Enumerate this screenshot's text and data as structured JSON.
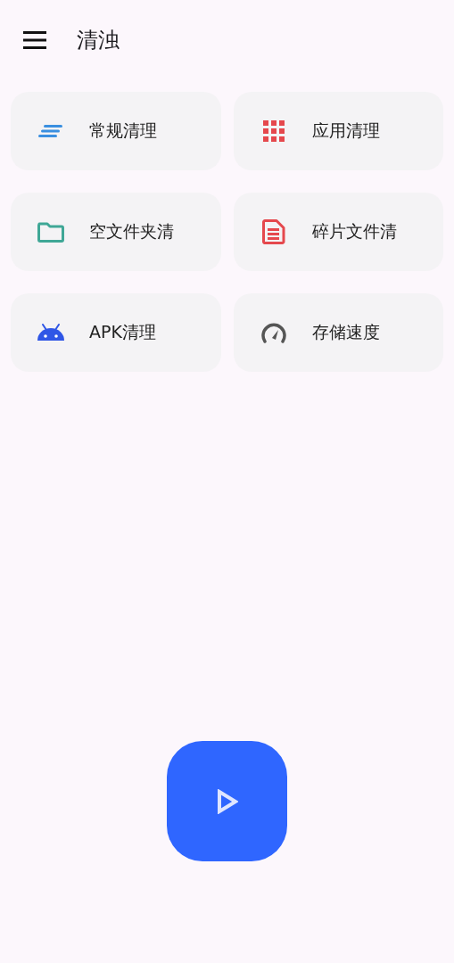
{
  "app_bar": {
    "title": "清浊"
  },
  "tools": [
    {
      "label": "常规清理",
      "kind": "lines"
    },
    {
      "label": "应用清理",
      "kind": "grid"
    },
    {
      "label": "空文件夹清",
      "kind": "folder"
    },
    {
      "label": "碎片文件清",
      "kind": "document"
    },
    {
      "label": "APK清理",
      "kind": "android"
    },
    {
      "label": "存储速度",
      "kind": "gauge"
    }
  ]
}
